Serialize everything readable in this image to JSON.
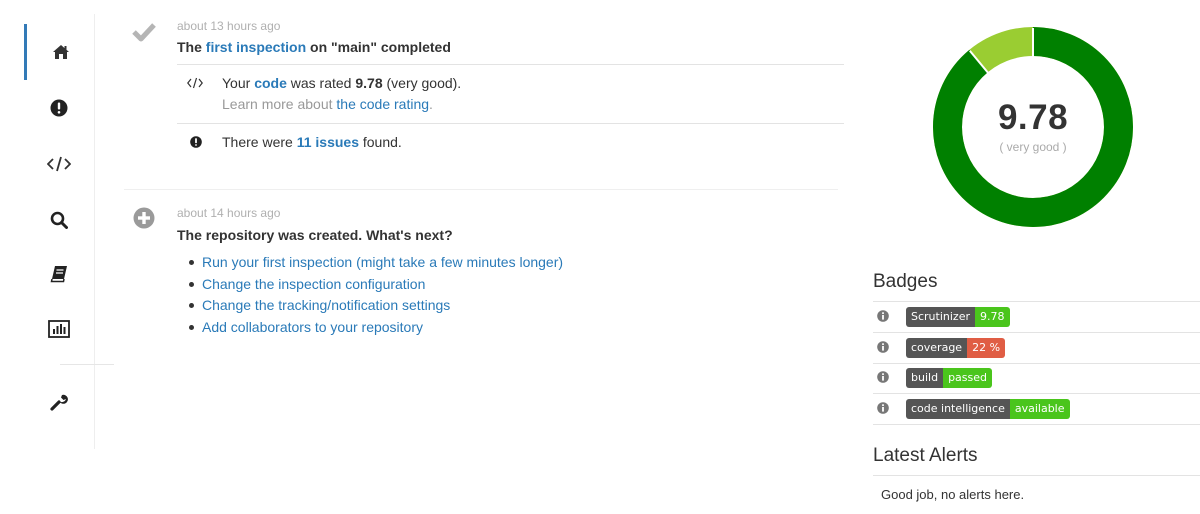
{
  "sidebar": {
    "items": [
      {
        "name": "home",
        "icon": "home-icon"
      },
      {
        "name": "issues",
        "icon": "exclamation-icon"
      },
      {
        "name": "code",
        "icon": "code-icon"
      },
      {
        "name": "search",
        "icon": "search-icon"
      },
      {
        "name": "book",
        "icon": "book-icon"
      },
      {
        "name": "statistics",
        "icon": "bar-chart-icon"
      },
      {
        "name": "settings",
        "icon": "wrench-icon"
      }
    ]
  },
  "feed": {
    "event1": {
      "time": "about 13 hours ago",
      "title_prefix": "The ",
      "title_link": "first inspection",
      "title_suffix": " on \"main\" completed",
      "rating": {
        "prefix": "Your ",
        "link": "code",
        "middle": " was rated ",
        "value": "9.78",
        "suffix": " (very good).",
        "learn_prefix": "Learn more about ",
        "learn_link": "the code rating",
        "learn_suffix": "."
      },
      "issues": {
        "prefix": "There were ",
        "link": "11 issues",
        "suffix": " found."
      }
    },
    "event2": {
      "time": "about 14 hours ago",
      "title": "The repository was created. What's next?",
      "next_steps": [
        "Run your first inspection (might take a few minutes longer)",
        "Change the inspection configuration",
        "Change the tracking/notification settings",
        "Add collaborators to your repository"
      ]
    }
  },
  "rating": {
    "score": "9.78",
    "label": "( very good )",
    "fraction": 0.8898,
    "colors": {
      "good": "#008000",
      "rest": "#9acd32"
    }
  },
  "badges": {
    "title": "Badges",
    "items": [
      {
        "key": "Scrutinizer",
        "value": "9.78",
        "color": "#4ac51c"
      },
      {
        "key": "coverage",
        "value": "22 %",
        "color": "#e05d44"
      },
      {
        "key": "build",
        "value": "passed",
        "color": "#4ac51c"
      },
      {
        "key": "code intelligence",
        "value": "available",
        "color": "#4ac51c"
      }
    ]
  },
  "alerts": {
    "title": "Latest Alerts",
    "text": "Good job, no alerts here."
  }
}
